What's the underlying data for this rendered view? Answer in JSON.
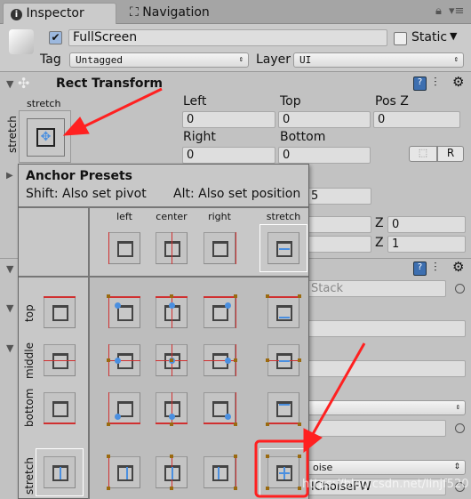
{
  "tabs": [
    {
      "label": "Inspector",
      "icon": "info-icon",
      "active": true
    },
    {
      "label": "Navigation",
      "icon": "navigation-icon",
      "active": false
    }
  ],
  "header": {
    "active": true,
    "name": "FullScreen",
    "static_label": "Static",
    "static": false,
    "tag_label": "Tag",
    "tag_value": "Untagged",
    "layer_label": "Layer",
    "layer_value": "UI"
  },
  "rect_transform": {
    "title": "Rect Transform",
    "anchor_h": "stretch",
    "anchor_v": "stretch",
    "fields": {
      "left_label": "Left",
      "left": "0",
      "top_label": "Top",
      "top": "0",
      "posz_label": "Pos Z",
      "posz": "0",
      "right_label": "Right",
      "right": "0",
      "bottom_label": "Bottom",
      "bottom": "0"
    },
    "r_button": "R"
  },
  "background": {
    "value_5": "5",
    "z_label": "Z",
    "z1": "0",
    "z2": "1",
    "stack": "Stack",
    "dropdown_partial": "oise",
    "field_partial": "lChoiseFW"
  },
  "anchor_presets": {
    "title": "Anchor Presets",
    "shift_hint": "Shift: Also set pivot",
    "alt_hint": "Alt: Also set position",
    "columns": [
      "left",
      "center",
      "right",
      "stretch"
    ],
    "rows": [
      "top",
      "middle",
      "bottom",
      "stretch"
    ],
    "selected": "stretch-stretch"
  },
  "watermark": "https://blog.csdn.net/linjf520",
  "colors": {
    "anchor_line": "#d03030",
    "anchor_dot": "#4a8fe0",
    "corner": "#9a6a10",
    "annotation": "#ff2020"
  }
}
